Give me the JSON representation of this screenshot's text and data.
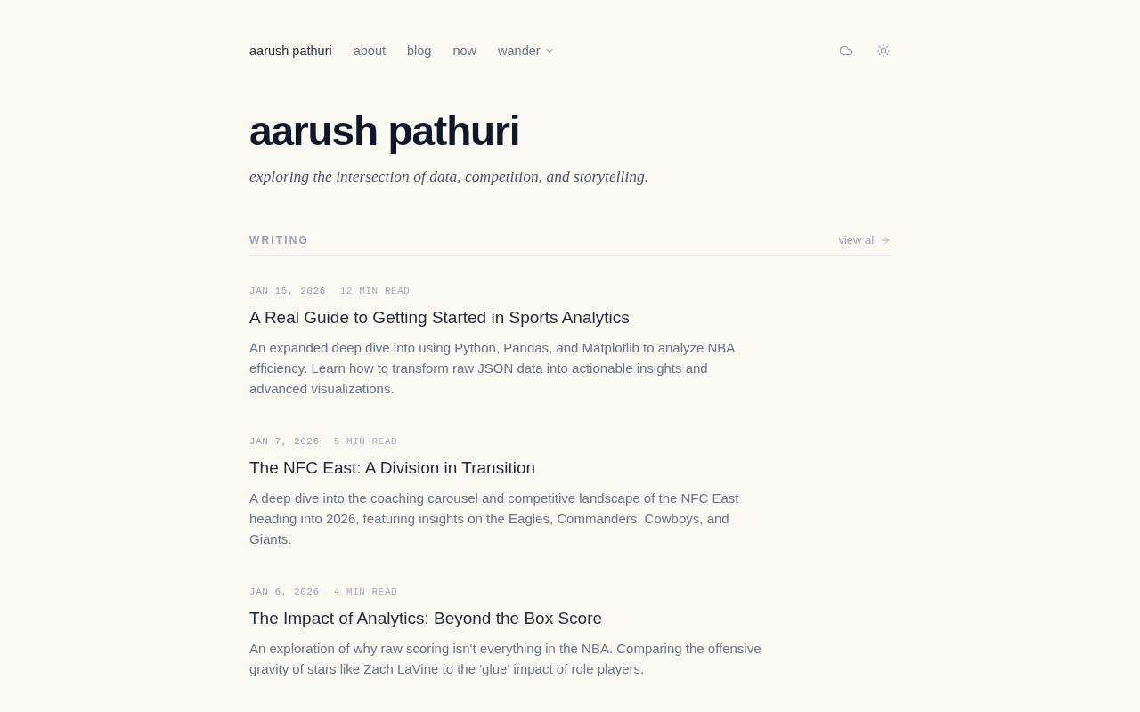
{
  "nav": {
    "brand": "aarush pathuri",
    "links": [
      {
        "label": "about",
        "kind": "link"
      },
      {
        "label": "blog",
        "kind": "link"
      },
      {
        "label": "now",
        "kind": "link"
      },
      {
        "label": "wander",
        "kind": "dropdown"
      }
    ]
  },
  "header": {
    "title": "aarush pathuri",
    "tagline": "exploring the intersection of data, competition, and storytelling."
  },
  "writing": {
    "heading": "WRITING",
    "view_all": "view all",
    "posts": [
      {
        "date": "JAN 15, 2026",
        "read_time": "12 MIN READ",
        "title": "A Real Guide to Getting Started in Sports Analytics",
        "excerpt": "An expanded deep dive into using Python, Pandas, and Matplotlib to analyze NBA efficiency. Learn how to transform raw JSON data into actionable insights and advanced visualizations."
      },
      {
        "date": "JAN 7, 2026",
        "read_time": "5 MIN READ",
        "title": "The NFC East: A Division in Transition",
        "excerpt": "A deep dive into the coaching carousel and competitive landscape of the NFC East heading into 2026, featuring insights on the Eagles, Commanders, Cowboys, and Giants."
      },
      {
        "date": "JAN 6, 2026",
        "read_time": "4 MIN READ",
        "title": "The Impact of Analytics: Beyond the Box Score",
        "excerpt": "An exploration of why raw scoring isn't everything in the NBA. Comparing the offensive gravity of stars like Zach LaVine to the 'glue' impact of role players."
      }
    ]
  }
}
